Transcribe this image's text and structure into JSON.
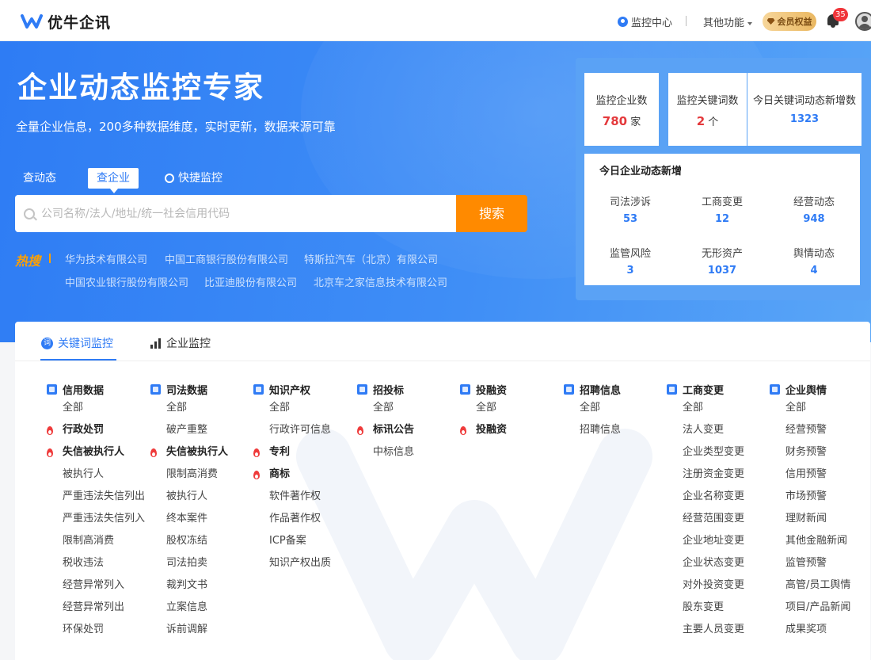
{
  "header": {
    "logo_text": "优牛企讯",
    "monitor_center": "监控中心",
    "other_features": "其他功能",
    "vip_label": "会员权益",
    "notif_count": "35"
  },
  "hero": {
    "title": "企业动态监控专家",
    "subtitle": "全量企业信息，200多种数据维度，实时更新，数据来源可靠",
    "tabs": [
      "查动态",
      "查企业",
      "快捷监控"
    ],
    "search_placeholder": "公司名称/法人/地址/统一社会信用代码",
    "search_button": "搜索",
    "hot_label": "热搜",
    "hot_items": [
      "华为技术有限公司",
      "中国工商银行股份有限公司",
      "特斯拉汽车（北京）有限公司",
      "中国农业银行股份有限公司",
      "比亚迪股份有限公司",
      "北京车之家信息技术有限公司"
    ]
  },
  "stats": {
    "top": [
      {
        "label": "监控企业数",
        "value": "780",
        "unit": "家"
      },
      {
        "label": "监控关键词数",
        "value": "2",
        "unit": "个"
      },
      {
        "label": "今日关键词动态新增数",
        "value": "1323",
        "unit": ""
      }
    ],
    "today_title": "今日企业动态新增",
    "today": [
      {
        "label": "司法涉诉",
        "value": "53"
      },
      {
        "label": "工商变更",
        "value": "12"
      },
      {
        "label": "经营动态",
        "value": "948"
      },
      {
        "label": "监管风险",
        "value": "3"
      },
      {
        "label": "无形资产",
        "value": "1037"
      },
      {
        "label": "舆情动态",
        "value": "4"
      }
    ]
  },
  "main": {
    "tabs": [
      "关键词监控",
      "企业监控"
    ],
    "columns": [
      {
        "title": "信用数据",
        "items": [
          {
            "label": "全部",
            "hot": false
          },
          {
            "label": "行政处罚",
            "hot": true
          },
          {
            "label": "失信被执行人",
            "hot": true
          },
          {
            "label": "被执行人",
            "hot": false
          },
          {
            "label": "严重违法失信列出",
            "hot": false
          },
          {
            "label": "严重违法失信列入",
            "hot": false
          },
          {
            "label": "限制高消费",
            "hot": false
          },
          {
            "label": "税收违法",
            "hot": false
          },
          {
            "label": "经营异常列入",
            "hot": false
          },
          {
            "label": "经营异常列出",
            "hot": false
          },
          {
            "label": "环保处罚",
            "hot": false
          }
        ]
      },
      {
        "title": "司法数据",
        "items": [
          {
            "label": "全部",
            "hot": false
          },
          {
            "label": "破产重整",
            "hot": false
          },
          {
            "label": "失信被执行人",
            "hot": true
          },
          {
            "label": "限制高消费",
            "hot": false
          },
          {
            "label": "被执行人",
            "hot": false
          },
          {
            "label": "终本案件",
            "hot": false
          },
          {
            "label": "股权冻结",
            "hot": false
          },
          {
            "label": "司法拍卖",
            "hot": false
          },
          {
            "label": "裁判文书",
            "hot": false
          },
          {
            "label": "立案信息",
            "hot": false
          },
          {
            "label": "诉前调解",
            "hot": false
          }
        ]
      },
      {
        "title": "知识产权",
        "items": [
          {
            "label": "全部",
            "hot": false
          },
          {
            "label": "行政许可信息",
            "hot": false
          },
          {
            "label": "专利",
            "hot": true
          },
          {
            "label": "商标",
            "hot": true
          },
          {
            "label": "软件著作权",
            "hot": false
          },
          {
            "label": "作品著作权",
            "hot": false
          },
          {
            "label": "ICP备案",
            "hot": false
          },
          {
            "label": "知识产权出质",
            "hot": false
          }
        ]
      },
      {
        "title": "招投标",
        "items": [
          {
            "label": "全部",
            "hot": false
          },
          {
            "label": "标讯公告",
            "hot": true
          },
          {
            "label": "中标信息",
            "hot": false
          }
        ]
      },
      {
        "title": "投融资",
        "items": [
          {
            "label": "全部",
            "hot": false
          },
          {
            "label": "投融资",
            "hot": true
          }
        ]
      },
      {
        "title": "招聘信息",
        "items": [
          {
            "label": "全部",
            "hot": false
          },
          {
            "label": "招聘信息",
            "hot": false
          }
        ]
      },
      {
        "title": "工商变更",
        "items": [
          {
            "label": "全部",
            "hot": false
          },
          {
            "label": "法人变更",
            "hot": false
          },
          {
            "label": "企业类型变更",
            "hot": false
          },
          {
            "label": "注册资金变更",
            "hot": false
          },
          {
            "label": "企业名称变更",
            "hot": false
          },
          {
            "label": "经营范围变更",
            "hot": false
          },
          {
            "label": "企业地址变更",
            "hot": false
          },
          {
            "label": "企业状态变更",
            "hot": false
          },
          {
            "label": "对外投资变更",
            "hot": false
          },
          {
            "label": "股东变更",
            "hot": false
          },
          {
            "label": "主要人员变更",
            "hot": false
          }
        ]
      },
      {
        "title": "企业舆情",
        "items": [
          {
            "label": "全部",
            "hot": false
          },
          {
            "label": "经营预警",
            "hot": false
          },
          {
            "label": "财务预警",
            "hot": false
          },
          {
            "label": "信用预警",
            "hot": false
          },
          {
            "label": "市场预警",
            "hot": false
          },
          {
            "label": "理财新闻",
            "hot": false
          },
          {
            "label": "其他金融新闻",
            "hot": false
          },
          {
            "label": "监管预警",
            "hot": false
          },
          {
            "label": "高管/员工舆情",
            "hot": false
          },
          {
            "label": "项目/产品新闻",
            "hot": false
          },
          {
            "label": "成果奖项",
            "hot": false
          }
        ]
      }
    ]
  }
}
